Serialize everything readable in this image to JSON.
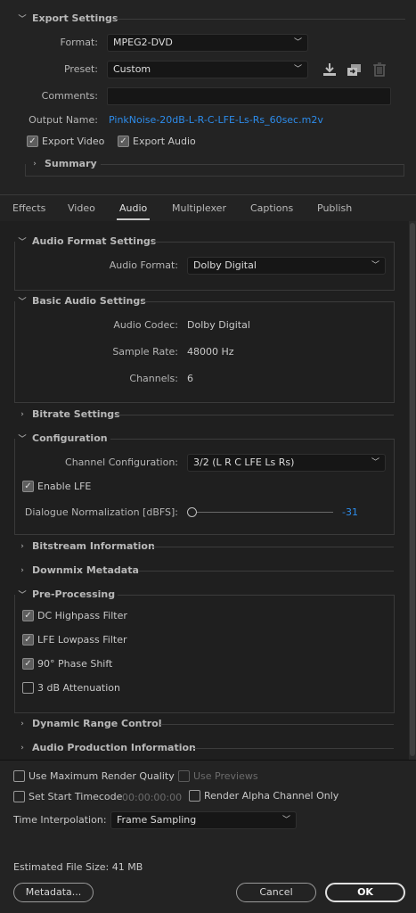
{
  "export_settings": {
    "title": "Export Settings",
    "format_label": "Format:",
    "format_value": "MPEG2-DVD",
    "preset_label": "Preset:",
    "preset_value": "Custom",
    "comments_label": "Comments:",
    "output_label": "Output Name:",
    "output_value": "PinkNoise-20dB-L-R-C-LFE-Ls-Rs_60sec.m2v",
    "export_video": "Export Video",
    "export_audio": "Export Audio",
    "summary": "Summary",
    "icons": [
      "save-preset-icon",
      "import-preset-icon",
      "delete-preset-icon"
    ]
  },
  "tabs": [
    "Effects",
    "Video",
    "Audio",
    "Multiplexer",
    "Captions",
    "Publish"
  ],
  "active_tab": "Audio",
  "audio_format": {
    "title": "Audio Format Settings",
    "label": "Audio Format:",
    "value": "Dolby Digital"
  },
  "basic_audio": {
    "title": "Basic Audio Settings",
    "codec_label": "Audio Codec:",
    "codec_value": "Dolby Digital",
    "rate_label": "Sample Rate:",
    "rate_value": "48000 Hz",
    "channels_label": "Channels:",
    "channels_value": "6"
  },
  "bitrate": {
    "title": "Bitrate Settings"
  },
  "configuration": {
    "title": "Configuration",
    "channel_label": "Channel Configuration:",
    "channel_value": "3/2 (L R C LFE Ls Rs)",
    "enable_lfe": "Enable LFE",
    "dialnorm_label": "Dialogue Normalization [dBFS]:",
    "dialnorm_value": "-31"
  },
  "bitstream": {
    "title": "Bitstream Information"
  },
  "downmix": {
    "title": "Downmix Metadata"
  },
  "preprocessing": {
    "title": "Pre-Processing",
    "dc_highpass": "DC Highpass Filter",
    "lfe_lowpass": "LFE Lowpass Filter",
    "phase_shift": "90° Phase Shift",
    "attenuation": "3 dB Attenuation"
  },
  "drc": {
    "title": "Dynamic Range Control"
  },
  "production": {
    "title": "Audio Production Information"
  },
  "bottom": {
    "max_quality": "Use Maximum Render Quality",
    "use_previews": "Use Previews",
    "start_timecode": "Set Start Timecode",
    "timecode_value": "00:00:00:00",
    "render_alpha": "Render Alpha Channel Only",
    "interp_label": "Time Interpolation:",
    "interp_value": "Frame Sampling",
    "file_size": "Estimated File Size:  41 MB",
    "metadata_btn": "Metadata...",
    "cancel_btn": "Cancel",
    "ok_btn": "OK"
  }
}
